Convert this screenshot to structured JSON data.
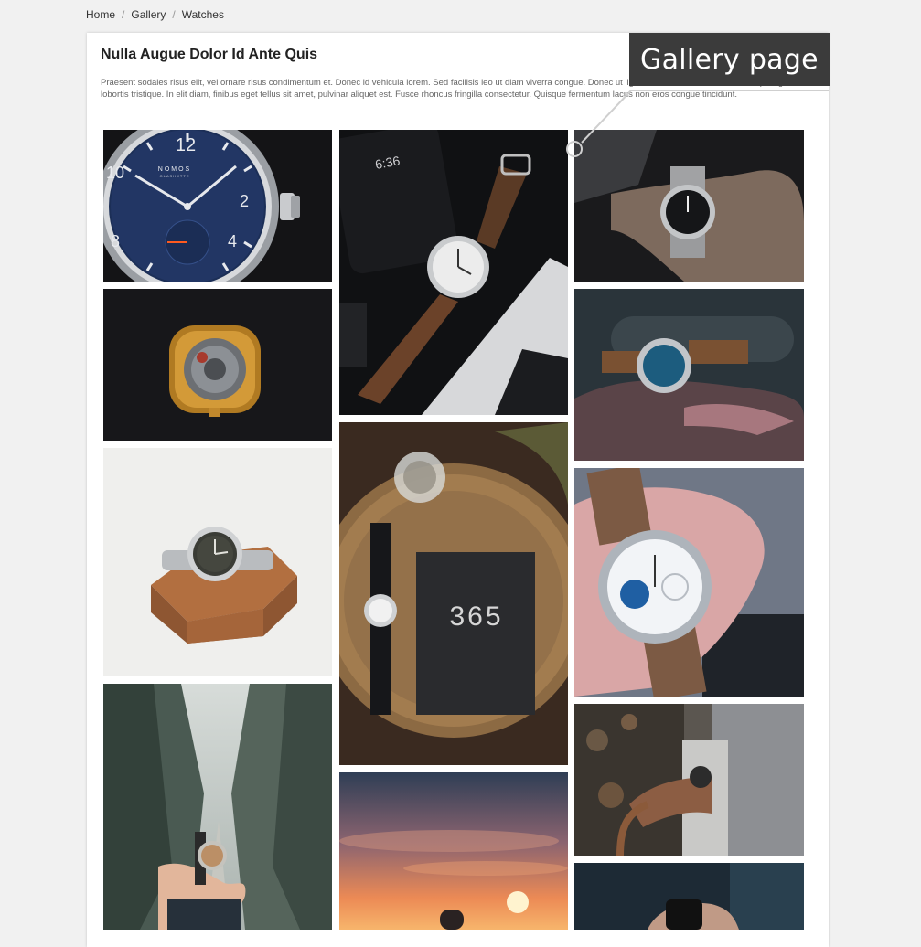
{
  "breadcrumb": {
    "items": [
      "Home",
      "Gallery",
      "Watches"
    ],
    "separator": "/"
  },
  "page": {
    "title": "Nulla Augue Dolor Id Ante Quis",
    "description": "Praesent sodales risus elit, vel ornare risus condimentum et. Donec id vehicula lorem. Sed facilisis leo ut diam viverra congue. Donec ut ligula ac felis varius luctus. Ut volutpat ligula et lobortis tristique. In elit diam, finibus eget tellus sit amet, pulvinar aliquet est. Fusce rhoncus fringilla consectetur. Quisque fermentum lacus non eros congue tincidunt."
  },
  "callout": {
    "label": "Gallery page"
  },
  "gallery": {
    "images": [
      {
        "subject": "blue dial wrist watch closeup",
        "dial_text": [
          "NOMOS",
          "GLASHÜTTE",
          "12",
          "2",
          "4",
          "8"
        ]
      },
      {
        "subject": "watch with brown leather strap next to phone",
        "phone_text": "6:36"
      },
      {
        "subject": "diver watch on wrist"
      },
      {
        "subject": "gold watch movement on black background"
      },
      {
        "subject": "watch on leather bag with blue dial"
      },
      {
        "subject": "steel watch on wooden hexagon block"
      },
      {
        "subject": "watch and notebook on woven placemat",
        "notebook_text": "365"
      },
      {
        "subject": "hand holding chronograph with leather strap"
      },
      {
        "subject": "hand holding watch in foggy forest"
      },
      {
        "subject": "sunset sky over sea"
      },
      {
        "subject": "person wearing watch holding bag"
      },
      {
        "subject": "hands fastening watch"
      }
    ]
  },
  "colors": {
    "page_bg": "#f1f1f1",
    "card_bg": "#ffffff",
    "callout_bg": "#3b3b3b"
  }
}
